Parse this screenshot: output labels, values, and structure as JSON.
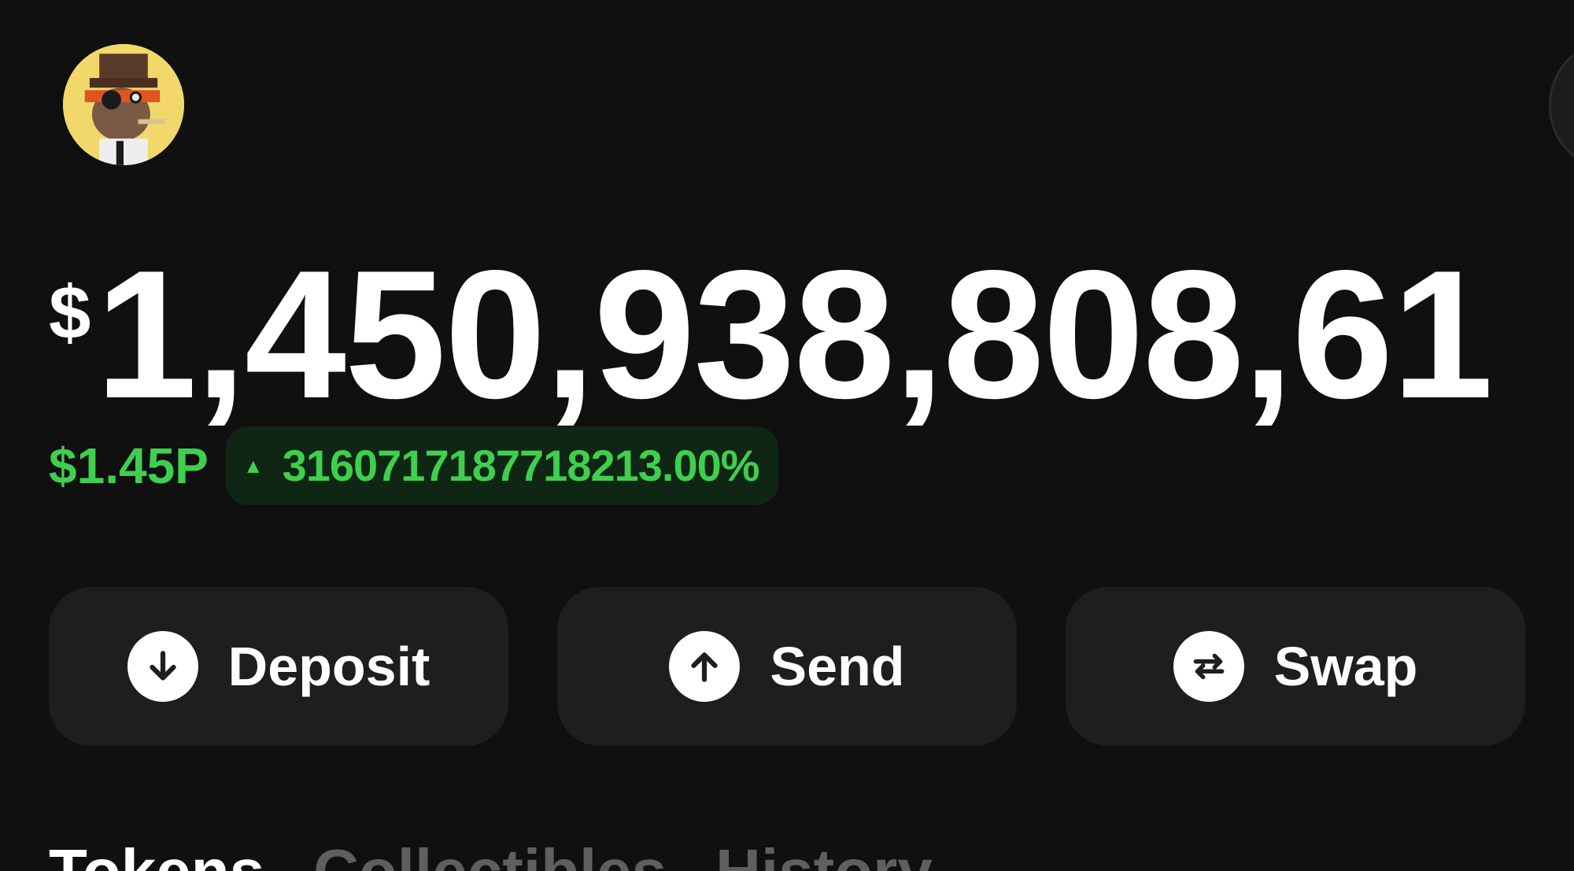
{
  "header": {
    "avatar_icon": "pixel-art-profile-avatar"
  },
  "balance": {
    "currency_symbol": "$",
    "amount": "1,450,938,808,61"
  },
  "change": {
    "value": "$1.45P",
    "arrow": "▲",
    "percent": "3160717187718213.00%",
    "color": "#3fcf4e"
  },
  "actions": [
    {
      "label": "Deposit",
      "icon": "arrow-down-circle-icon"
    },
    {
      "label": "Send",
      "icon": "arrow-up-circle-icon"
    },
    {
      "label": "Swap",
      "icon": "swap-arrows-circle-icon"
    }
  ],
  "tabs": [
    {
      "label": "Tokens",
      "active": true
    },
    {
      "label": "Collectibles",
      "active": false
    },
    {
      "label": "History",
      "active": false
    }
  ],
  "colors": {
    "background": "#101010",
    "button_background": "#1e1e1e",
    "positive": "#3fcf4e",
    "pill_background": "#0f2614",
    "inactive_tab": "#5f5f5f"
  }
}
